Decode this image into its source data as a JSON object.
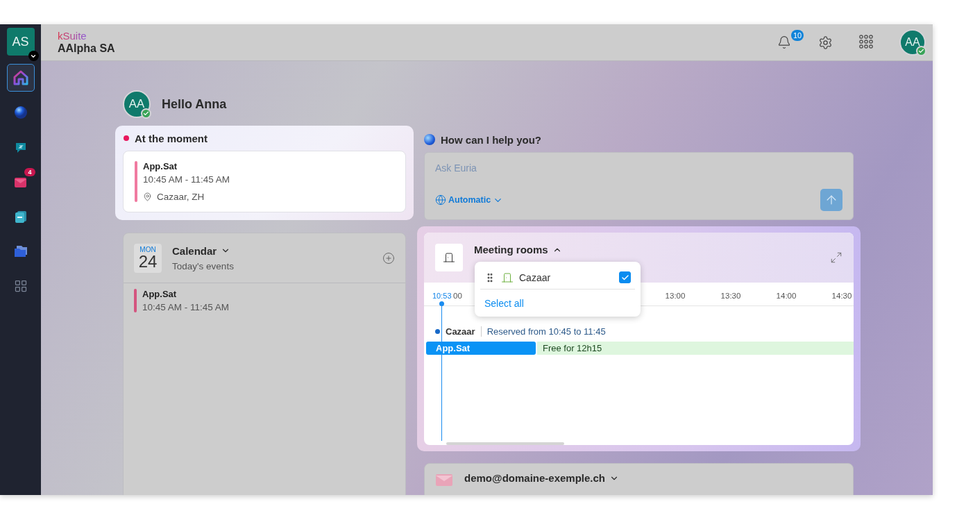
{
  "sidebar": {
    "account": {
      "initials": "AS"
    },
    "items": [
      {
        "kind": "home",
        "selected": true
      },
      {
        "kind": "euria",
        "selected": false
      },
      {
        "kind": "chat",
        "selected": false
      },
      {
        "kind": "mail",
        "selected": false,
        "badge": "4"
      },
      {
        "kind": "calendar",
        "selected": false
      },
      {
        "kind": "drive",
        "selected": false
      },
      {
        "kind": "apps",
        "selected": false
      }
    ]
  },
  "topbar": {
    "brand": "kSuite",
    "organization": "AAlpha SA",
    "notifications": "10",
    "user": {
      "initials": "AA",
      "online": true
    }
  },
  "greeting": {
    "initials": "AA",
    "online": true,
    "text": "Hello Anna"
  },
  "at_the_moment": {
    "title": "At the moment",
    "event": {
      "title": "App.Sat",
      "time": "10:45 AM - 11:45 AM",
      "location": "Cazaar, ZH"
    }
  },
  "assistant": {
    "title": "How can I help you?",
    "placeholder": "Ask Euria",
    "mode": "Automatic"
  },
  "calendar": {
    "weekday": "MON",
    "day": "24",
    "title": "Calendar",
    "subtitle": "Today's events",
    "events": [
      {
        "title": "App.Sat",
        "time": "10:45 AM - 11:45 AM"
      }
    ]
  },
  "meeting_rooms": {
    "title": "Meeting rooms",
    "expanded": true,
    "now": "10:53",
    "ticks": [
      "00",
      "13:00",
      "13:30",
      "14:00",
      "14:30"
    ],
    "rooms": [
      {
        "name": "Cazaar",
        "status": "Reserved from 10:45 to 11:45",
        "booking": "App.Sat",
        "free": "Free for 12h15"
      }
    ],
    "dropdown": {
      "items": [
        {
          "name": "Cazaar",
          "checked": true
        }
      ],
      "select_all": "Select all"
    }
  },
  "mail": {
    "address": "demo@domaine-exemple.ch"
  }
}
